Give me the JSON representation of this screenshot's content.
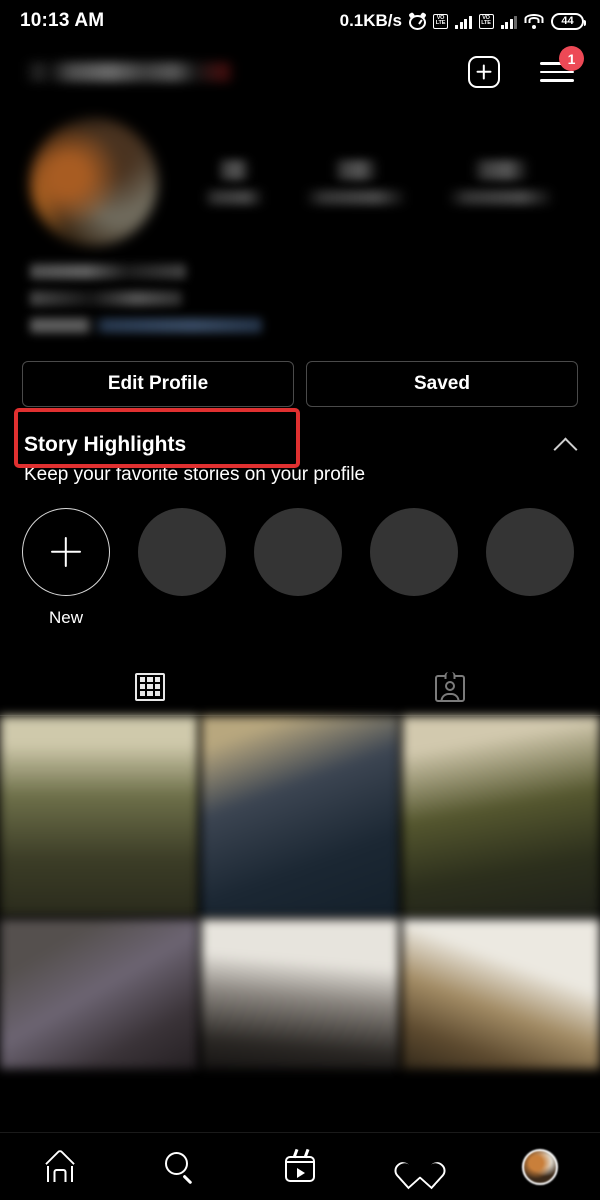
{
  "status_bar": {
    "time": "10:13 AM",
    "network_speed": "0.1KB/s",
    "alarm_icon": "alarm-clock-icon",
    "sim1_label_top": "VO",
    "sim1_label_bottom": "LTE",
    "sim2_label_top": "VO",
    "sim2_label_bottom": "LTE",
    "wifi_icon": "wifi-icon",
    "battery_level": "44"
  },
  "header": {
    "username": "",
    "new_post_icon": "plus-square-icon",
    "menu_icon": "hamburger-menu-icon",
    "menu_badge_count": "1"
  },
  "profile": {
    "avatar": "profile-avatar",
    "stats": [
      {
        "value": "",
        "label": ""
      },
      {
        "value": "",
        "label": ""
      },
      {
        "value": "",
        "label": ""
      }
    ],
    "bio_lines": [
      "",
      "",
      ""
    ]
  },
  "action_buttons": {
    "edit_profile_label": "Edit Profile",
    "saved_label": "Saved",
    "highlight_color": "#E03030",
    "highlighted_button": "Edit Profile"
  },
  "story_highlights": {
    "title": "Story Highlights",
    "subtitle": "Keep your favorite stories on your profile",
    "collapse_icon": "chevron-up-icon",
    "new_label": "New",
    "new_icon": "plus-icon",
    "placeholder_count": 4
  },
  "content_tabs": [
    {
      "name": "grid-tab",
      "icon": "grid-icon",
      "active": true
    },
    {
      "name": "tagged-tab",
      "icon": "tagged-photos-icon",
      "active": false
    }
  ],
  "photo_grid": {
    "row1": [
      "post-1",
      "post-2",
      "post-3"
    ],
    "row2": [
      "post-4",
      "post-5",
      "post-6"
    ]
  },
  "bottom_nav": [
    {
      "name": "home-tab",
      "icon": "home-icon",
      "active": false
    },
    {
      "name": "search-tab",
      "icon": "search-icon",
      "active": false
    },
    {
      "name": "reels-tab",
      "icon": "reels-icon",
      "active": false
    },
    {
      "name": "activity-tab",
      "icon": "heart-icon",
      "active": false
    },
    {
      "name": "profile-tab",
      "icon": "profile-avatar-icon",
      "active": true
    }
  ]
}
